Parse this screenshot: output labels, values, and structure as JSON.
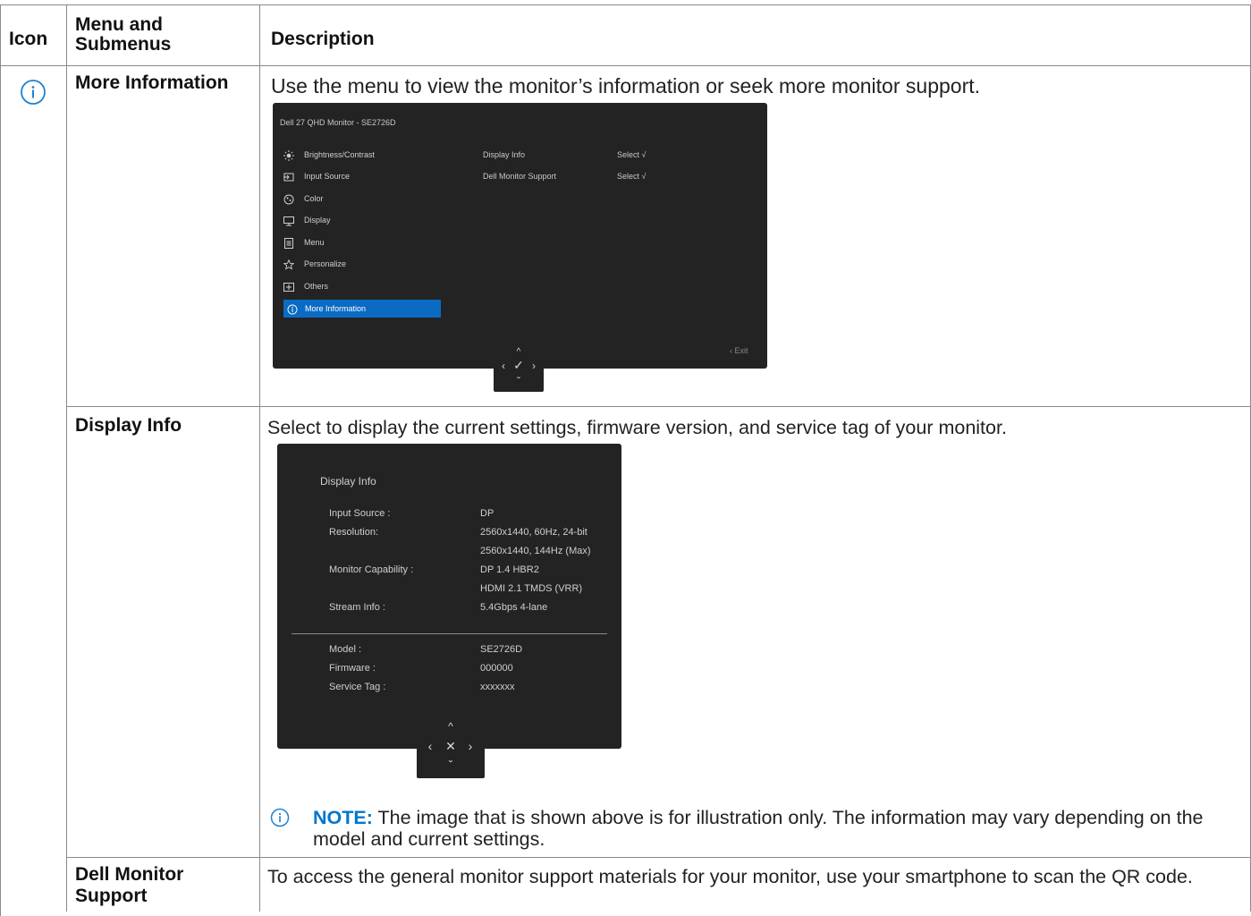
{
  "table": {
    "headers": {
      "icon": "Icon",
      "menu": "Menu and Submenus",
      "description": "Description"
    },
    "rows": {
      "more_information": {
        "menu": "More Information",
        "description": "Use the menu to view the monitor’s information or seek more monitor support."
      },
      "display_info": {
        "menu": "Display Info",
        "description": "Select to display the current settings, firmware version, and service tag of your monitor."
      },
      "dell_monitor_support": {
        "menu": "Dell Monitor Support",
        "description": "To access the general monitor support materials for your monitor, use your smartphone to scan the QR code."
      }
    }
  },
  "osd_main": {
    "title": "Dell 27 QHD Monitor - SE2726D",
    "menu_items": [
      {
        "label": "Brightness/Contrast",
        "icon": "brightness-icon"
      },
      {
        "label": "Input Source",
        "icon": "input-source-icon"
      },
      {
        "label": "Color",
        "icon": "color-icon"
      },
      {
        "label": "Display",
        "icon": "display-icon"
      },
      {
        "label": "Menu",
        "icon": "menu-icon"
      },
      {
        "label": "Personalize",
        "icon": "star-icon"
      },
      {
        "label": "Others",
        "icon": "others-icon"
      },
      {
        "label": "More Information",
        "icon": "info-icon",
        "selected": true
      }
    ],
    "submenu": [
      {
        "label": "Display Info",
        "action": "Select √"
      },
      {
        "label": "Dell Monitor Support",
        "action": "Select √"
      }
    ],
    "exit_label": "‹ Exit",
    "joystick": {
      "up": "^",
      "left": "‹",
      "center": "✓",
      "right": "›",
      "down": "ˇ"
    },
    "accent_color": "#0b6bc4"
  },
  "osd_info": {
    "title": "Display Info",
    "fields": [
      {
        "label": "Input Source :",
        "value": "DP"
      },
      {
        "label": "Resolution:",
        "value": "2560x1440, 60Hz, 24-bit"
      },
      {
        "label": "",
        "value": "2560x1440, 144Hz (Max)"
      },
      {
        "label": "Monitor Capability :",
        "value": "DP 1.4 HBR2"
      },
      {
        "label": "",
        "value": "HDMI 2.1 TMDS (VRR)"
      },
      {
        "label": "Stream Info :",
        "value": "5.4Gbps 4-lane"
      }
    ],
    "fields_bottom": [
      {
        "label": "Model :",
        "value": "SE2726D"
      },
      {
        "label": "Firmware :",
        "value": "000000"
      },
      {
        "label": "Service Tag :",
        "value": "xxxxxxx"
      }
    ],
    "joystick": {
      "up": "^",
      "left": "‹",
      "center": "✕",
      "right": "›",
      "down": "ˇ"
    }
  },
  "note": {
    "label": "NOTE:",
    "text": " The image that is shown above is for illustration only. The information may vary depending on the model and current settings.",
    "label_color": "#0076ce"
  }
}
